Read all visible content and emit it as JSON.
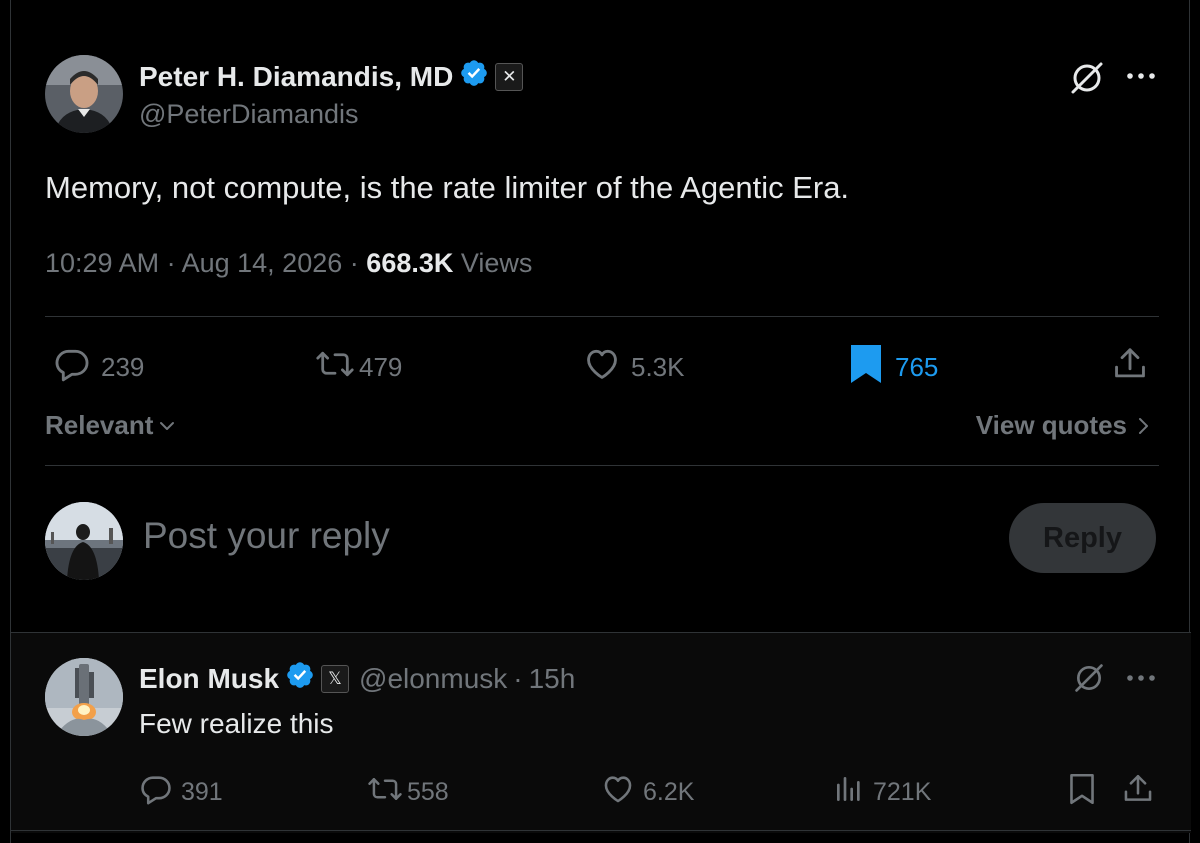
{
  "post": {
    "author_name": "Peter H. Diamandis, MD",
    "author_handle": "@PeterDiamandis",
    "affiliation_badge": "✕",
    "text": "Memory, not compute, is the rate limiter of the Agentic Era.",
    "time": "10:29 AM",
    "sep1": "·",
    "date": "Aug 14, 2026",
    "sep2": "·",
    "views_count": "668.3K",
    "views_label": "Views",
    "replies": "239",
    "reposts": "479",
    "likes": "5.3K",
    "bookmarks": "765",
    "sort_label": "Relevant",
    "view_quotes_label": "View quotes"
  },
  "composer": {
    "placeholder": "Post your reply",
    "reply_button": "Reply"
  },
  "reply": {
    "author_name": "Elon Musk",
    "affiliation_badge": "𝕏",
    "author_handle": "@elonmusk",
    "sep": "·",
    "age": "15h",
    "text": "Few realize this",
    "replies": "391",
    "reposts": "558",
    "likes": "6.2K",
    "views": "721K"
  },
  "colors": {
    "background": "#000000",
    "text_primary": "#e7e9ea",
    "text_secondary": "#71767b",
    "accent_blue": "#1d9bf0",
    "divider": "#2f3336"
  },
  "icons": [
    "verified-badge-icon",
    "grok-icon",
    "more-icon",
    "reply-icon",
    "repost-icon",
    "like-icon",
    "bookmark-icon",
    "share-icon",
    "chevron-down-icon",
    "chevron-right-icon",
    "views-icon"
  ]
}
